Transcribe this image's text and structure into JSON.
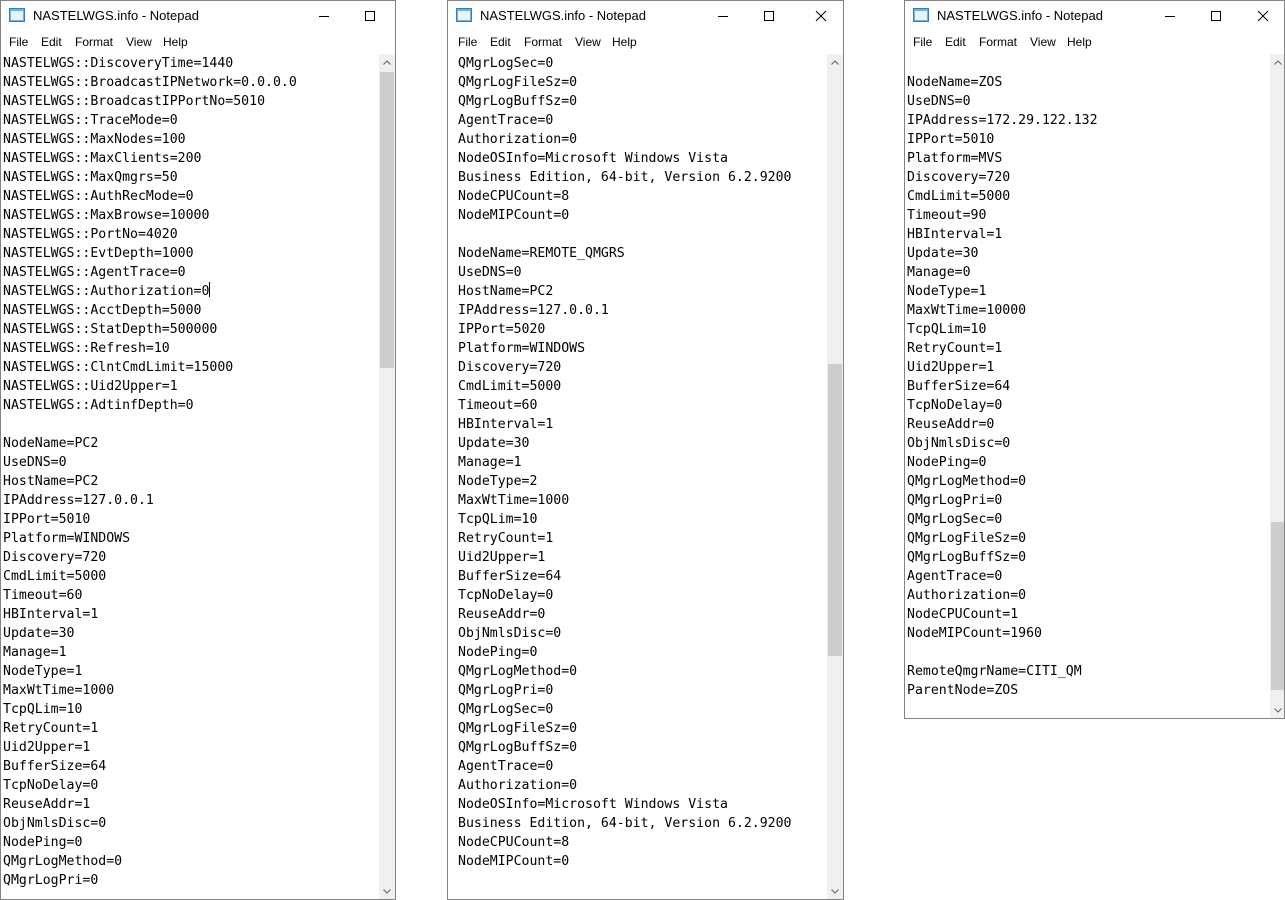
{
  "windows": [
    {
      "title": "NASTELWGS.info - Notepad",
      "menu": [
        "File",
        "Edit",
        "Format",
        "View",
        "Help"
      ],
      "lines": [
        "NASTELWGS::DiscoveryTime=1440",
        "NASTELWGS::BroadcastIPNetwork=0.0.0.0",
        "NASTELWGS::BroadcastIPPortNo=5010",
        "NASTELWGS::TraceMode=0",
        "NASTELWGS::MaxNodes=100",
        "NASTELWGS::MaxClients=200",
        "NASTELWGS::MaxQmgrs=50",
        "NASTELWGS::AuthRecMode=0",
        "NASTELWGS::MaxBrowse=10000",
        "NASTELWGS::PortNo=4020",
        "NASTELWGS::EvtDepth=1000",
        "NASTELWGS::AgentTrace=0",
        "NASTELWGS::Authorization=0",
        "NASTELWGS::AcctDepth=5000",
        "NASTELWGS::StatDepth=500000",
        "NASTELWGS::Refresh=10",
        "NASTELWGS::ClntCmdLimit=15000",
        "NASTELWGS::Uid2Upper=1",
        "NASTELWGS::AdtinfDepth=0",
        "",
        "NodeName=PC2",
        "UseDNS=0",
        "HostName=PC2",
        "IPAddress=127.0.0.1",
        "IPPort=5010",
        "Platform=WINDOWS",
        "Discovery=720",
        "CmdLimit=5000",
        "Timeout=60",
        "HBInterval=1",
        "Update=30",
        "Manage=1",
        "NodeType=1",
        "MaxWtTime=1000",
        "TcpQLim=10",
        "RetryCount=1",
        "Uid2Upper=1",
        "BufferSize=64",
        "TcpNoDelay=0",
        "ReuseAddr=1",
        "ObjNmlsDisc=0",
        "NodePing=0",
        "QMgrLogMethod=0",
        "QMgrLogPri=0"
      ],
      "caret_line": 12
    },
    {
      "title": "NASTELWGS.info - Notepad",
      "menu": [
        "File",
        "Edit",
        "Format",
        "View",
        "Help"
      ],
      "lines": [
        "QMgrLogSec=0",
        "QMgrLogFileSz=0",
        "QMgrLogBuffSz=0",
        "AgentTrace=0",
        "Authorization=0",
        "NodeOSInfo=Microsoft Windows Vista",
        "Business Edition, 64-bit, Version 6.2.9200",
        "NodeCPUCount=8",
        "NodeMIPCount=0",
        "",
        "NodeName=REMOTE_QMGRS",
        "UseDNS=0",
        "HostName=PC2",
        "IPAddress=127.0.0.1",
        "IPPort=5020",
        "Platform=WINDOWS",
        "Discovery=720",
        "CmdLimit=5000",
        "Timeout=60",
        "HBInterval=1",
        "Update=30",
        "Manage=1",
        "NodeType=2",
        "MaxWtTime=1000",
        "TcpQLim=10",
        "RetryCount=1",
        "Uid2Upper=1",
        "BufferSize=64",
        "TcpNoDelay=0",
        "ReuseAddr=0",
        "ObjNmlsDisc=0",
        "NodePing=0",
        "QMgrLogMethod=0",
        "QMgrLogPri=0",
        "QMgrLogSec=0",
        "QMgrLogFileSz=0",
        "QMgrLogBuffSz=0",
        "AgentTrace=0",
        "Authorization=0",
        "NodeOSInfo=Microsoft Windows Vista",
        "Business Edition, 64-bit, Version 6.2.9200",
        "NodeCPUCount=8",
        "NodeMIPCount=0"
      ]
    },
    {
      "title": "NASTELWGS.info - Notepad",
      "menu": [
        "File",
        "Edit",
        "Format",
        "View",
        "Help"
      ],
      "lines": [
        "",
        "NodeName=ZOS",
        "UseDNS=0",
        "IPAddress=172.29.122.132",
        "IPPort=5010",
        "Platform=MVS",
        "Discovery=720",
        "CmdLimit=5000",
        "Timeout=90",
        "HBInterval=1",
        "Update=30",
        "Manage=0",
        "NodeType=1",
        "MaxWtTime=10000",
        "TcpQLim=10",
        "RetryCount=1",
        "Uid2Upper=1",
        "BufferSize=64",
        "TcpNoDelay=0",
        "ReuseAddr=0",
        "ObjNmlsDisc=0",
        "NodePing=0",
        "QMgrLogMethod=0",
        "QMgrLogPri=0",
        "QMgrLogSec=0",
        "QMgrLogFileSz=0",
        "QMgrLogBuffSz=0",
        "AgentTrace=0",
        "Authorization=0",
        "NodeCPUCount=1",
        "NodeMIPCount=1960",
        "",
        "RemoteQmgrName=CITI_QM",
        "ParentNode=ZOS"
      ]
    }
  ]
}
